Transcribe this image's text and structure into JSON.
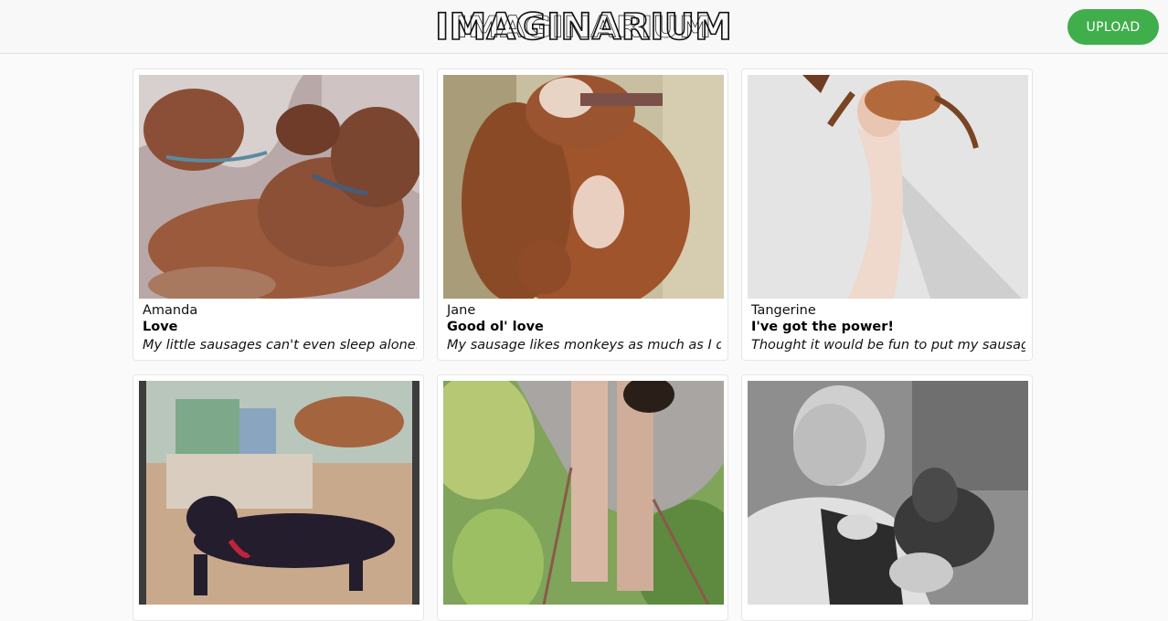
{
  "header": {
    "logo_text": "IMAGINARIUM",
    "upload_label": "UPLOAD",
    "upload_color": "#3fae4b"
  },
  "posts": [
    {
      "author": "Amanda",
      "title": "Love",
      "description": "My little sausages can't even sleep alone.",
      "image": "two dachshunds cuddling asleep"
    },
    {
      "author": "Jane",
      "title": "Good ol' love",
      "description": "My sausage likes monkeys as much as I do!",
      "image": "dachshund hugging plush monkey"
    },
    {
      "author": "Tangerine",
      "title": "I've got the power!",
      "description": "Thought it would be fun to put my sausage",
      "image": "hand holding dachshund in the air"
    },
    {
      "author": "",
      "title": "",
      "description": "",
      "image": "dachshunds with dog food"
    },
    {
      "author": "",
      "title": "",
      "description": "",
      "image": "dachshund in a knitted hammock"
    },
    {
      "author": "",
      "title": "",
      "description": "",
      "image": "old man holding a dachshund"
    }
  ]
}
